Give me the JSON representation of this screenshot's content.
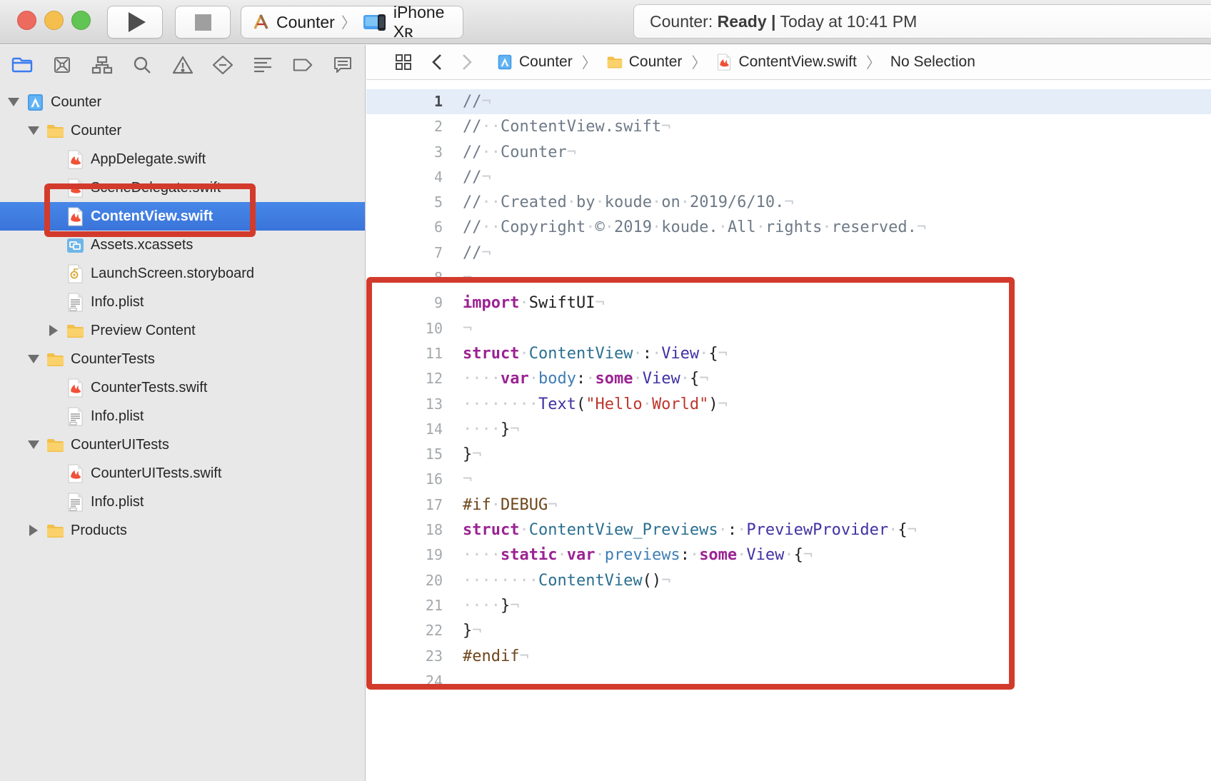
{
  "colors": {
    "accent_blue": "#3a7bf0",
    "traffic_red": "#ed6a5e",
    "traffic_yellow": "#f5bf4f",
    "traffic_green": "#61c554",
    "annotation_red": "#d23b2c",
    "selection_blue": "#3c79e1"
  },
  "toolbar": {
    "scheme": {
      "project": "Counter",
      "destination": "iPhone Xʀ"
    },
    "status": {
      "prefix": "Counter: ",
      "bold": "Ready |",
      "suffix": " Today at 10:41 PM"
    }
  },
  "navigator": {
    "selected_index": 0,
    "icons": [
      "project-navigator",
      "source-control-navigator",
      "symbol-navigator",
      "find-navigator",
      "issue-navigator",
      "test-navigator",
      "debug-navigator",
      "breakpoint-navigator",
      "report-navigator"
    ],
    "tree": [
      {
        "label": "Counter",
        "icon": "project",
        "level": 0,
        "disclosure": "expanded"
      },
      {
        "label": "Counter",
        "icon": "folder",
        "level": 1,
        "disclosure": "expanded"
      },
      {
        "label": "AppDelegate.swift",
        "icon": "swift",
        "level": 2,
        "disclosure": "none"
      },
      {
        "label": "SceneDelegate.swift",
        "icon": "swift",
        "level": 2,
        "disclosure": "none"
      },
      {
        "label": "ContentView.swift",
        "icon": "swift",
        "level": 2,
        "disclosure": "none",
        "selected": true
      },
      {
        "label": "Assets.xcassets",
        "icon": "assets",
        "level": 2,
        "disclosure": "none"
      },
      {
        "label": "LaunchScreen.storyboard",
        "icon": "storyboard",
        "level": 2,
        "disclosure": "none"
      },
      {
        "label": "Info.plist",
        "icon": "plist",
        "level": 2,
        "disclosure": "none"
      },
      {
        "label": "Preview Content",
        "icon": "folder",
        "level": 2,
        "disclosure": "collapsed"
      },
      {
        "label": "CounterTests",
        "icon": "folder",
        "level": 1,
        "disclosure": "expanded"
      },
      {
        "label": "CounterTests.swift",
        "icon": "swift",
        "level": 2,
        "disclosure": "none"
      },
      {
        "label": "Info.plist",
        "icon": "plist",
        "level": 2,
        "disclosure": "none"
      },
      {
        "label": "CounterUITests",
        "icon": "folder",
        "level": 1,
        "disclosure": "expanded"
      },
      {
        "label": "CounterUITests.swift",
        "icon": "swift",
        "level": 2,
        "disclosure": "none"
      },
      {
        "label": "Info.plist",
        "icon": "plist",
        "level": 2,
        "disclosure": "none"
      },
      {
        "label": "Products",
        "icon": "folder",
        "level": 1,
        "disclosure": "collapsed"
      }
    ]
  },
  "jump_bar": {
    "crumbs": [
      {
        "icon": "project",
        "label": "Counter"
      },
      {
        "icon": "folder",
        "label": "Counter"
      },
      {
        "icon": "swift",
        "label": "ContentView.swift"
      },
      {
        "icon": null,
        "label": "No Selection"
      }
    ]
  },
  "editor": {
    "current_line": 1,
    "colors": {
      "com": "#6e7a87",
      "kw": "#9b2393",
      "tp": "#2a6f8f",
      "ts": "#4031a4",
      "pr": "#3f7db5",
      "st": "#be372c",
      "pp": "#6e4519",
      "pl": "#1f1f1f",
      "ws": "#c9cdd2"
    },
    "lines": [
      [
        [
          "//",
          "com"
        ],
        [
          "¬",
          "ws"
        ]
      ],
      [
        [
          "//",
          "com"
        ],
        [
          "··",
          "ws"
        ],
        [
          "ContentView.swift",
          "com"
        ],
        [
          "¬",
          "ws"
        ]
      ],
      [
        [
          "//",
          "com"
        ],
        [
          "··",
          "ws"
        ],
        [
          "Counter",
          "com"
        ],
        [
          "¬",
          "ws"
        ]
      ],
      [
        [
          "//",
          "com"
        ],
        [
          "¬",
          "ws"
        ]
      ],
      [
        [
          "//",
          "com"
        ],
        [
          "··",
          "ws"
        ],
        [
          "Created",
          "com"
        ],
        [
          "·",
          "ws"
        ],
        [
          "by",
          "com"
        ],
        [
          "·",
          "ws"
        ],
        [
          "koude",
          "com"
        ],
        [
          "·",
          "ws"
        ],
        [
          "on",
          "com"
        ],
        [
          "·",
          "ws"
        ],
        [
          "2019/6/10.",
          "com"
        ],
        [
          "¬",
          "ws"
        ]
      ],
      [
        [
          "//",
          "com"
        ],
        [
          "··",
          "ws"
        ],
        [
          "Copyright",
          "com"
        ],
        [
          "·",
          "ws"
        ],
        [
          "©",
          "com"
        ],
        [
          "·",
          "ws"
        ],
        [
          "2019",
          "com"
        ],
        [
          "·",
          "ws"
        ],
        [
          "koude.",
          "com"
        ],
        [
          "·",
          "ws"
        ],
        [
          "All",
          "com"
        ],
        [
          "·",
          "ws"
        ],
        [
          "rights",
          "com"
        ],
        [
          "·",
          "ws"
        ],
        [
          "reserved.",
          "com"
        ],
        [
          "¬",
          "ws"
        ]
      ],
      [
        [
          "//",
          "com"
        ],
        [
          "¬",
          "ws"
        ]
      ],
      [
        [
          "¬",
          "ws"
        ]
      ],
      [
        [
          "import",
          "kw"
        ],
        [
          "·",
          "ws"
        ],
        [
          "SwiftUI",
          "pl"
        ],
        [
          "¬",
          "ws"
        ]
      ],
      [
        [
          "¬",
          "ws"
        ]
      ],
      [
        [
          "struct",
          "kw"
        ],
        [
          "·",
          "ws"
        ],
        [
          "ContentView",
          "tp"
        ],
        [
          "·",
          "ws"
        ],
        [
          ":",
          "pl"
        ],
        [
          "·",
          "ws"
        ],
        [
          "View",
          "ts"
        ],
        [
          "·",
          "ws"
        ],
        [
          "{",
          "pl"
        ],
        [
          "¬",
          "ws"
        ]
      ],
      [
        [
          "····",
          "ws"
        ],
        [
          "var",
          "kw"
        ],
        [
          "·",
          "ws"
        ],
        [
          "body",
          "pr"
        ],
        [
          ":",
          "pl"
        ],
        [
          "·",
          "ws"
        ],
        [
          "some",
          "kw"
        ],
        [
          "·",
          "ws"
        ],
        [
          "View",
          "ts"
        ],
        [
          "·",
          "ws"
        ],
        [
          "{",
          "pl"
        ],
        [
          "¬",
          "ws"
        ]
      ],
      [
        [
          "········",
          "ws"
        ],
        [
          "Text",
          "ts"
        ],
        [
          "(",
          "pl"
        ],
        [
          "\"Hello",
          "st"
        ],
        [
          "·",
          "ws"
        ],
        [
          "World\"",
          "st"
        ],
        [
          ")",
          "pl"
        ],
        [
          "¬",
          "ws"
        ]
      ],
      [
        [
          "····",
          "ws"
        ],
        [
          "}",
          "pl"
        ],
        [
          "¬",
          "ws"
        ]
      ],
      [
        [
          "}",
          "pl"
        ],
        [
          "¬",
          "ws"
        ]
      ],
      [
        [
          "¬",
          "ws"
        ]
      ],
      [
        [
          "#if",
          "pp"
        ],
        [
          "·",
          "ws"
        ],
        [
          "DEBUG",
          "pp"
        ],
        [
          "¬",
          "ws"
        ]
      ],
      [
        [
          "struct",
          "kw"
        ],
        [
          "·",
          "ws"
        ],
        [
          "ContentView_Previews",
          "tp"
        ],
        [
          "·",
          "ws"
        ],
        [
          ":",
          "pl"
        ],
        [
          "·",
          "ws"
        ],
        [
          "PreviewProvider",
          "ts"
        ],
        [
          "·",
          "ws"
        ],
        [
          "{",
          "pl"
        ],
        [
          "¬",
          "ws"
        ]
      ],
      [
        [
          "····",
          "ws"
        ],
        [
          "static",
          "kw"
        ],
        [
          "·",
          "ws"
        ],
        [
          "var",
          "kw"
        ],
        [
          "·",
          "ws"
        ],
        [
          "previews",
          "pr"
        ],
        [
          ":",
          "pl"
        ],
        [
          "·",
          "ws"
        ],
        [
          "some",
          "kw"
        ],
        [
          "·",
          "ws"
        ],
        [
          "View",
          "ts"
        ],
        [
          "·",
          "ws"
        ],
        [
          "{",
          "pl"
        ],
        [
          "¬",
          "ws"
        ]
      ],
      [
        [
          "········",
          "ws"
        ],
        [
          "ContentView",
          "tp"
        ],
        [
          "()",
          "pl"
        ],
        [
          "¬",
          "ws"
        ]
      ],
      [
        [
          "····",
          "ws"
        ],
        [
          "}",
          "pl"
        ],
        [
          "¬",
          "ws"
        ]
      ],
      [
        [
          "}",
          "pl"
        ],
        [
          "¬",
          "ws"
        ]
      ],
      [
        [
          "#endif",
          "pp"
        ],
        [
          "¬",
          "ws"
        ]
      ],
      []
    ]
  }
}
